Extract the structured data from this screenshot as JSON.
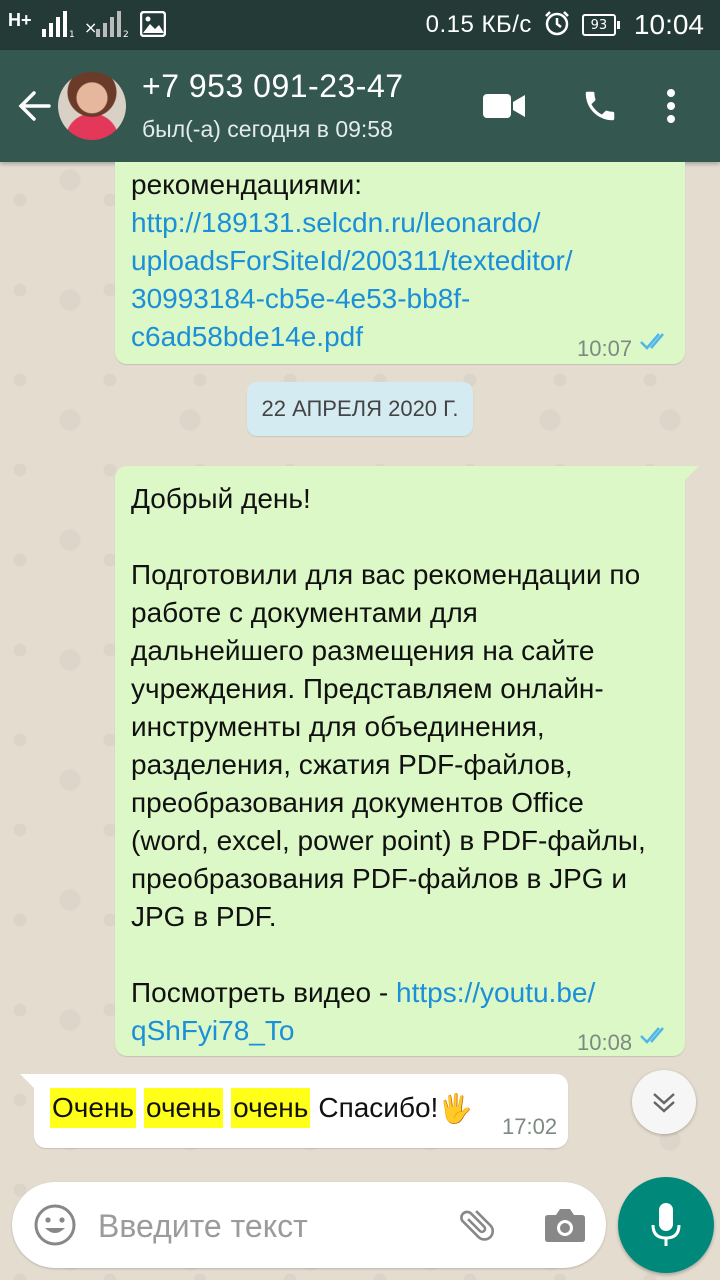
{
  "status_bar": {
    "network": "H+",
    "data_speed": "0.15 КБ/с",
    "battery": "93",
    "time": "10:04",
    "sim1": "1",
    "sim2": "2"
  },
  "header": {
    "contact_name": "+7 953 091-23-47",
    "last_seen": "был(-а) сегодня в 09:58"
  },
  "messages": [
    {
      "type": "outgoing",
      "lines_text": "рекомендациями:",
      "link": "http://189131.selcdn.ru/leonardo/uploadsForSiteId/200311/texteditor/30993184-cb5e-4e53-bb8f-c6ad58bde14e.pdf",
      "link_lines": [
        "http://189131.selcdn.ru/leonardo/",
        "uploadsForSiteId/200311/texteditor/",
        "30993184-cb5e-4e53-bb8f-",
        "c6ad58bde14e.pdf"
      ],
      "time": "10:07"
    },
    {
      "type": "date",
      "label": "22 АПРЕЛЯ 2020 Г."
    },
    {
      "type": "outgoing",
      "greeting": "Добрый день!",
      "body_lines": [
        "Подготовили для вас рекомендации по",
        "работе с документами для",
        "дальнейшего размещения на сайте",
        "учреждения. Представляем онлайн-",
        "инструменты для объединения,",
        "разделения, сжатия PDF-файлов,",
        "преобразования документов Office",
        "(word, excel, power point) в PDF-файлы,",
        "преобразования PDF-файлов в JPG и",
        "JPG в PDF."
      ],
      "video_prefix": "Посмотреть видео - ",
      "video_link_lines": [
        "https://youtu.be/",
        "qShFyi78_To"
      ],
      "time": "10:08"
    },
    {
      "type": "incoming",
      "words": [
        "Очень",
        "очень",
        "очень"
      ],
      "tail_text": "Спасибо!",
      "emoji": "🖐",
      "time": "17:02"
    }
  ],
  "input": {
    "placeholder": "Введите текст"
  },
  "colors": {
    "header": "#34574f",
    "status_bar": "#243a36",
    "outgoing_bubble": "#dcf8c6",
    "link": "#1b8fd8",
    "read_ticks": "#4fb6ec",
    "highlight": "#ffff1a",
    "mic_button": "#00897b"
  },
  "icons": [
    "back-arrow-icon",
    "video-call-icon",
    "phone-icon",
    "more-vert-icon",
    "double-check-icon",
    "chevron-down-icon",
    "emoji-icon",
    "attach-icon",
    "camera-icon",
    "mic-icon",
    "image-icon",
    "alarm-icon",
    "signal-icon"
  ]
}
